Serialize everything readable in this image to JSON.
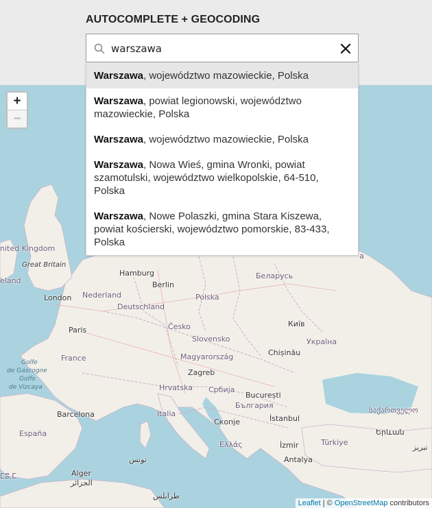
{
  "title": "AUTOCOMPLETE + GEOCODING",
  "search": {
    "value": "warszawa"
  },
  "results": [
    {
      "name": "Warszawa",
      "rest": ", województwo mazowieckie, Polska",
      "active": true
    },
    {
      "name": "Warszawa",
      "rest": ", powiat legionowski, województwo mazowieckie, Polska",
      "active": false
    },
    {
      "name": "Warszawa",
      "rest": ", województwo mazowieckie, Polska",
      "active": false
    },
    {
      "name": "Warszawa",
      "rest": ", Nowa Wieś, gmina Wronki, powiat szamotulski, województwo wielkopolskie, 64-510, Polska",
      "active": false
    },
    {
      "name": "Warszawa",
      "rest": ", Nowe Polaszki, gmina Stara Kiszewa, powiat kościerski, województwo pomorskie, 83-433, Polska",
      "active": false
    }
  ],
  "zoom": {
    "in": "+",
    "out": "−"
  },
  "map_labels": {
    "united_kingdom": "nited Kingdom",
    "great_britain": "Great Britain",
    "ireland": "eland",
    "london": "London",
    "nederland": "Nederland",
    "hamburg": "Hamburg",
    "berlin": "Berlin",
    "deutschland": "Deutschland",
    "polska": "Polska",
    "belarus": "Беларусь",
    "paris": "Paris",
    "france": "France",
    "cesko": "Česko",
    "slovensko": "Slovensko",
    "kyiv": "Київ",
    "ukraina": "Україна",
    "chisinau": "Chișinău",
    "magyarorszag": "Magyarország",
    "zagreb": "Zagreb",
    "hrvatska": "Hrvatska",
    "srbija": "Србија",
    "bucuresti": "București",
    "bulgaria": "България",
    "barcelona": "Barcelona",
    "italia": "Italia",
    "skopje": "Скопје",
    "istanbul": "İstanbul",
    "georgia": "საქართველო",
    "espana": "España",
    "ellas": "Ελλάς",
    "izmir": "İzmir",
    "turkiye": "Türkiye",
    "armenia": "Երևան",
    "tabriz": "تبریز",
    "tunis": "تونس",
    "algiers": "Alger",
    "algiers_ar": "الجزائر",
    "antalya": "Antalya",
    "tripoli": "طرابلس",
    "golfe": "Golfe de Gascogne / Golfo de Vizcaya",
    "golfe_1": "Golfe",
    "golfe_2": "de Gascogne",
    "golfe_3": "Golfo",
    "golfe_4": "de Vizcaya",
    "ma": "ⵎⵓ.ⵎ",
    "a_fragment": "a"
  },
  "attribution": {
    "leaflet": "Leaflet",
    "sep": " | © ",
    "osm": "OpenStreetMap",
    "contrib": " contributors"
  }
}
